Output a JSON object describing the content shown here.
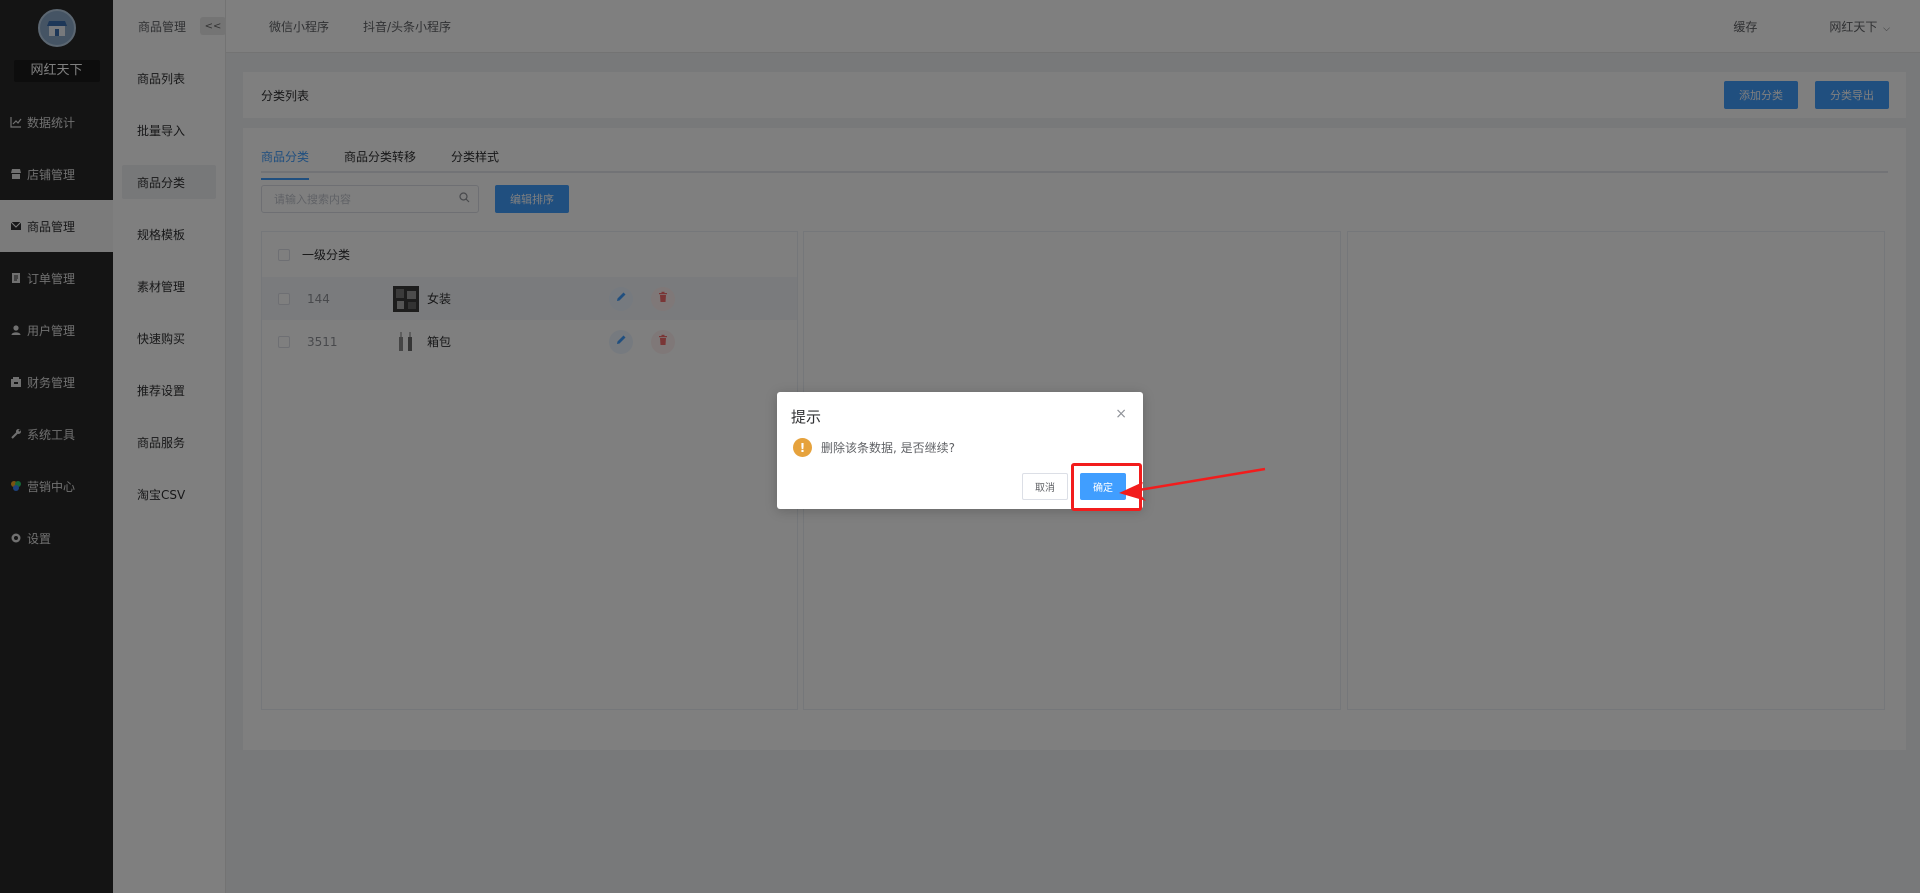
{
  "brand": "网红天下",
  "sidebar": {
    "items": [
      {
        "label": "数据统计",
        "icon": "chart-line-icon"
      },
      {
        "label": "店铺管理",
        "icon": "store-icon"
      },
      {
        "label": "商品管理",
        "icon": "mail-box-icon"
      },
      {
        "label": "订单管理",
        "icon": "order-icon"
      },
      {
        "label": "用户管理",
        "icon": "user-icon"
      },
      {
        "label": "财务管理",
        "icon": "finance-icon"
      },
      {
        "label": "系统工具",
        "icon": "wrench-icon"
      },
      {
        "label": "营销中心",
        "icon": "marketing-icon"
      },
      {
        "label": "设置",
        "icon": "gear-icon"
      }
    ],
    "active_index": 2
  },
  "subsidebar": {
    "header": "商品管理",
    "collapse": "<<",
    "items": [
      "商品列表",
      "批量导入",
      "商品分类",
      "规格模板",
      "素材管理",
      "快速购买",
      "推荐设置",
      "商品服务",
      "淘宝CSV"
    ],
    "active_index": 2
  },
  "topbar": {
    "tabs": [
      "微信小程序",
      "抖音/头条小程序"
    ],
    "cache": "缓存",
    "user": "网红天下"
  },
  "page": {
    "title": "分类列表",
    "add_button": "添加分类",
    "export_button": "分类导出",
    "tabs": [
      "商品分类",
      "商品分类转移",
      "分类样式"
    ],
    "active_tab": 0,
    "search_placeholder": "请输入搜索内容",
    "sort_button": "编辑排序",
    "panel_header": "一级分类",
    "rows": [
      {
        "id": "144",
        "name": "女装"
      },
      {
        "id": "3511",
        "name": "箱包"
      }
    ]
  },
  "dialog": {
    "title": "提示",
    "close": "×",
    "message": "删除该条数据, 是否继续?",
    "cancel": "取消",
    "confirm": "确定"
  },
  "colors": {
    "primary": "#409eff",
    "danger": "#f56c6c",
    "warning": "#e6a23c",
    "highlight": "#f21c1c"
  }
}
